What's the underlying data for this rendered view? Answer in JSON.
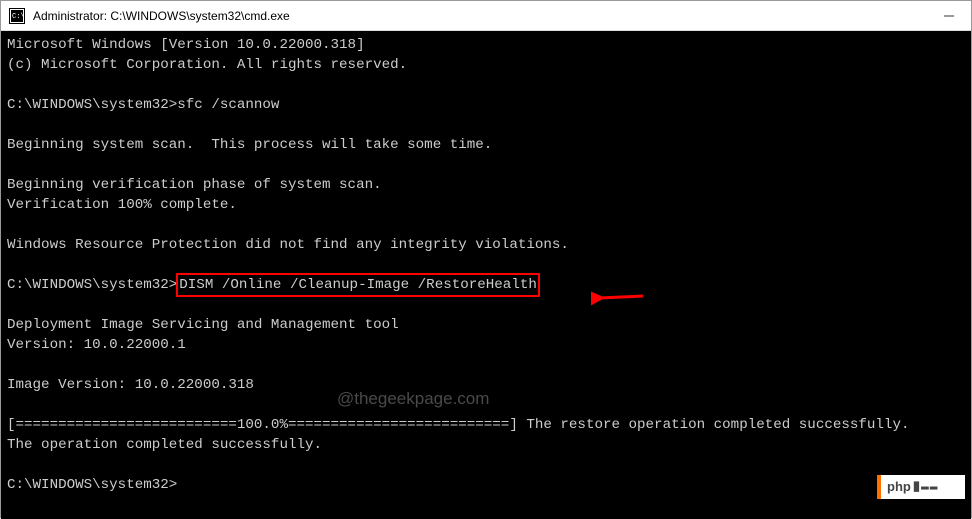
{
  "titlebar": {
    "title": "Administrator: C:\\WINDOWS\\system32\\cmd.exe"
  },
  "terminal": {
    "line1": "Microsoft Windows [Version 10.0.22000.318]",
    "line2": "(c) Microsoft Corporation. All rights reserved.",
    "blank": "",
    "prompt1_prefix": "C:\\WINDOWS\\system32>",
    "prompt1_cmd": "sfc /scannow",
    "scan1": "Beginning system scan.  This process will take some time.",
    "scan2": "Beginning verification phase of system scan.",
    "scan3": "Verification 100% complete.",
    "scan4": "Windows Resource Protection did not find any integrity violations.",
    "prompt2_prefix": "C:\\WINDOWS\\system32>",
    "prompt2_cmd": "DISM /Online /Cleanup-Image /RestoreHealth",
    "dism1": "Deployment Image Servicing and Management tool",
    "dism2": "Version: 10.0.22000.1",
    "dism3": "Image Version: 10.0.22000.318",
    "progress": "[==========================100.0%==========================] The restore operation completed successfully.",
    "done": "The operation completed successfully.",
    "prompt3": "C:\\WINDOWS\\system32>"
  },
  "watermark": "@thegeekpage.com",
  "badge": {
    "text": "php"
  }
}
